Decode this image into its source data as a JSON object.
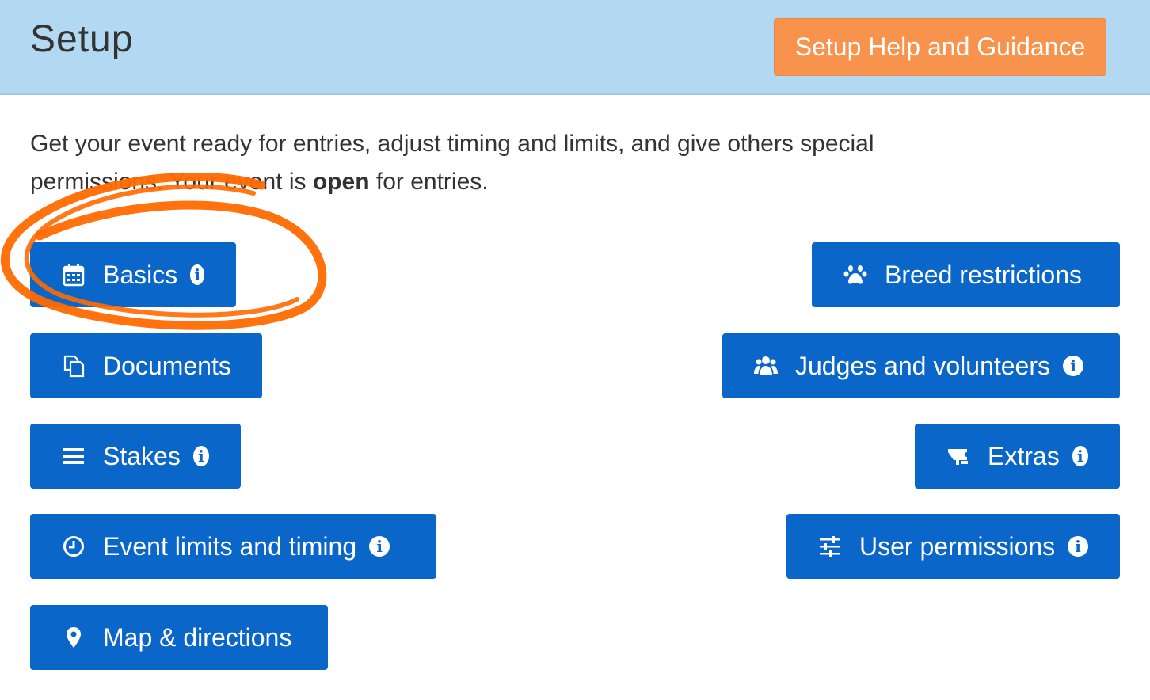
{
  "header": {
    "title": "Setup",
    "help_button": "Setup Help and Guidance"
  },
  "intro": {
    "line1": "Get your event ready for entries, adjust timing and limits, and give others special",
    "prefix": "permissions. Your event is ",
    "status": "open",
    "suffix": " for entries."
  },
  "buttons": {
    "basics": "Basics",
    "documents": "Documents",
    "stakes": "Stakes",
    "event_limits": "Event limits and timing",
    "map": "Map & directions",
    "breed": "Breed restrictions",
    "judges": "Judges and volunteers",
    "extras": "Extras",
    "user_permissions": "User permissions"
  },
  "icons": {
    "basics": "calendar-icon",
    "documents": "documents-icon",
    "stakes": "list-icon",
    "event_limits": "clock-icon",
    "map": "map-marker-icon",
    "breed": "paw-icon",
    "judges": "users-icon",
    "extras": "ticket-icon",
    "user_permissions": "sliders-icon",
    "info": "info-icon"
  },
  "colors": {
    "header_bg": "#b3d9f2",
    "help_button_bg": "#f7934c",
    "button_bg": "#0a67c9",
    "annotation": "#ff6a00"
  }
}
